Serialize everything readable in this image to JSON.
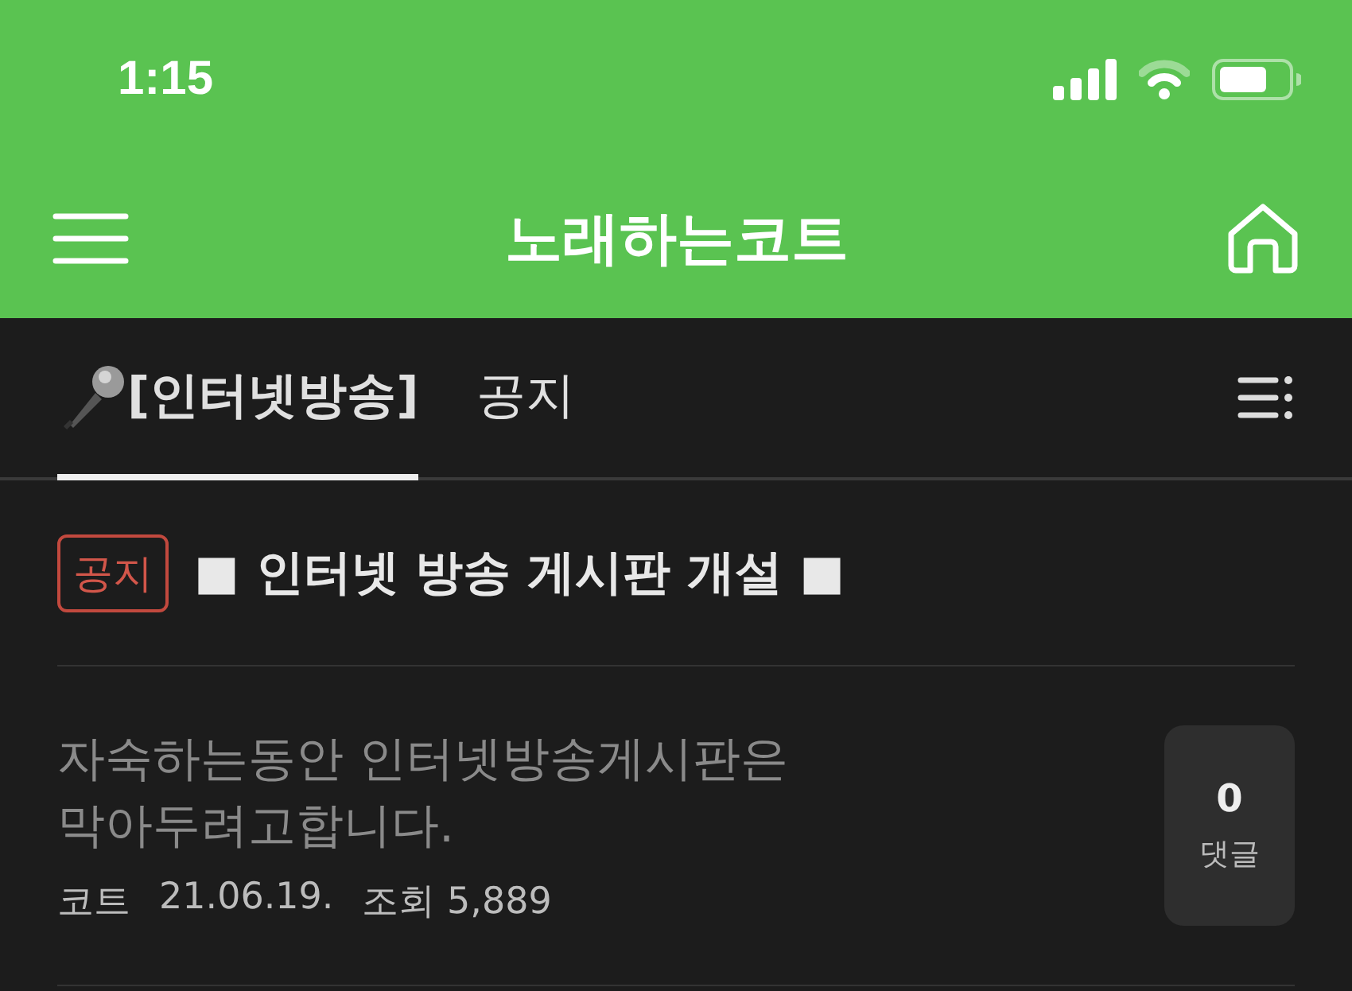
{
  "status_bar": {
    "time": "1:15"
  },
  "header": {
    "title": "노래하는코트"
  },
  "tabs": [
    {
      "label": "[인터넷방송]",
      "kind": "icon",
      "selected": true
    },
    {
      "label": "공지",
      "kind": "plain",
      "selected": false
    }
  ],
  "notice": {
    "badge": "공지",
    "title": "■ 인터넷 방송 게시판 개설 ■"
  },
  "posts": [
    {
      "title": "자숙하는동안 인터넷방송게시판은 막아두려고합니다.",
      "author": "코트",
      "date": "21.06.19.",
      "views": "조회 5,889",
      "comment_count": "0",
      "comment_label": "댓글"
    }
  ]
}
